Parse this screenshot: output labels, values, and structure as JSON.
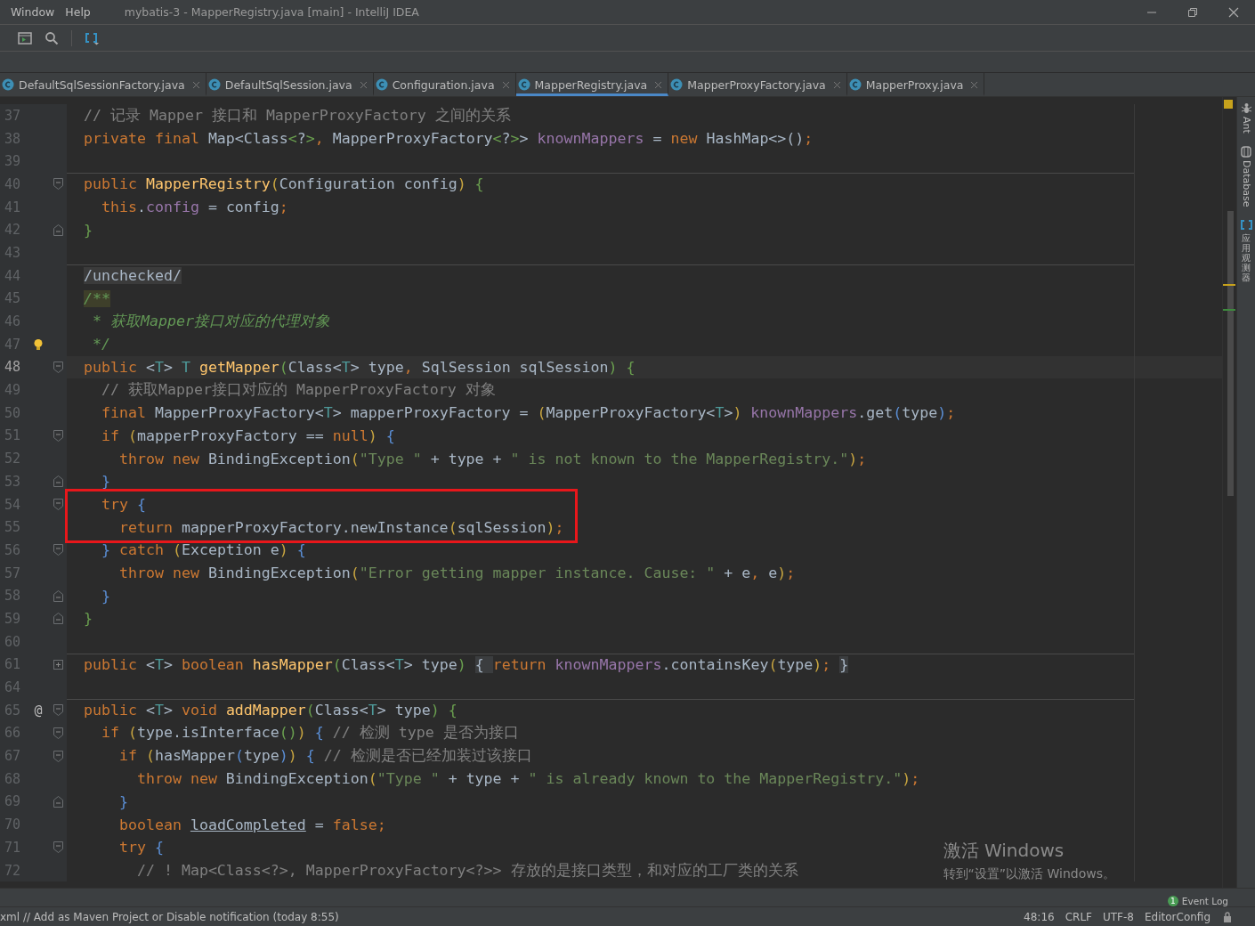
{
  "title_bar": {
    "menu": [
      "Window",
      "Help"
    ],
    "title": "mybatis-3 - MapperRegistry.java [main] - IntelliJ IDEA"
  },
  "tabs": [
    {
      "label": "DefaultSqlSessionFactory.java",
      "selected": false
    },
    {
      "label": "DefaultSqlSession.java",
      "selected": false
    },
    {
      "label": "Configuration.java",
      "selected": false
    },
    {
      "label": "MapperRegistry.java",
      "selected": true
    },
    {
      "label": "MapperProxyFactory.java",
      "selected": false
    },
    {
      "label": "MapperProxy.java",
      "selected": false
    }
  ],
  "tool_strip": [
    {
      "kind": "ant",
      "label": "Ant"
    },
    {
      "kind": "database",
      "label": "Database"
    },
    {
      "kind": "observer",
      "label": "应用观测器"
    }
  ],
  "editor": {
    "lines": [
      {
        "number": "37",
        "current": false,
        "highlighted": false,
        "divider_above": false,
        "code": [
          {
            "kind": "cm",
            "text": "// 记录 Mapper 接口和 MapperProxyFactory 之间的关系"
          }
        ]
      },
      {
        "number": "38",
        "current": false,
        "highlighted": false,
        "divider_above": false,
        "code": [
          {
            "kind": "kw",
            "text": "private final "
          },
          {
            "kind": "pl",
            "text": "Map<Class"
          },
          {
            "kind": "g",
            "text": "<"
          },
          {
            "kind": "pl",
            "text": "?"
          },
          {
            "kind": "g",
            "text": ">"
          },
          {
            "kind": "kw",
            "text": ", "
          },
          {
            "kind": "pl",
            "text": "MapperProxyFactory"
          },
          {
            "kind": "g",
            "text": "<"
          },
          {
            "kind": "pl",
            "text": "?"
          },
          {
            "kind": "g",
            "text": ">"
          },
          {
            "kind": "pl",
            "text": "> "
          },
          {
            "kind": "fld",
            "text": "knownMappers"
          },
          {
            "kind": "pl",
            "text": " = "
          },
          {
            "kind": "kw",
            "text": "new "
          },
          {
            "kind": "pl",
            "text": "HashMap<>()"
          },
          {
            "kind": "kw",
            "text": ";"
          }
        ]
      },
      {
        "number": "39",
        "current": false,
        "highlighted": false,
        "divider_above": false
      },
      {
        "number": "40",
        "current": false,
        "highlighted": false,
        "divider_above": true,
        "fold": {
          "kind": "start"
        },
        "code": [
          {
            "kind": "kw",
            "text": "public "
          },
          {
            "kind": "fn",
            "text": "MapperRegistry"
          },
          {
            "kind": "y",
            "text": "("
          },
          {
            "kind": "pl",
            "text": "Configuration config"
          },
          {
            "kind": "y",
            "text": ")"
          },
          {
            "kind": "g",
            "text": " {"
          }
        ]
      },
      {
        "number": "41",
        "current": false,
        "highlighted": false,
        "divider_above": false,
        "code": [
          {
            "kind": "kw",
            "text": "  this"
          },
          {
            "kind": "pl",
            "text": "."
          },
          {
            "kind": "fld",
            "text": "config"
          },
          {
            "kind": "pl",
            "text": " = config"
          },
          {
            "kind": "kw",
            "text": ";"
          }
        ]
      },
      {
        "number": "42",
        "current": false,
        "highlighted": false,
        "divider_above": false,
        "fold": {
          "kind": "end"
        },
        "code": [
          {
            "kind": "g",
            "text": "}"
          }
        ]
      },
      {
        "number": "43",
        "current": false,
        "highlighted": false,
        "divider_above": false
      },
      {
        "number": "44",
        "current": false,
        "highlighted": false,
        "divider_above": true,
        "code": [
          {
            "kind": "ann",
            "text": "/unchecked/"
          }
        ]
      },
      {
        "number": "45",
        "current": false,
        "highlighted": false,
        "divider_above": false,
        "code": [
          {
            "kind": "docm",
            "text": "/**"
          }
        ]
      },
      {
        "number": "46",
        "current": false,
        "highlighted": false,
        "divider_above": false,
        "code": [
          {
            "kind": "doc",
            "text": " * 获取Mapper接口对应的代理对象"
          }
        ]
      },
      {
        "number": "47",
        "current": false,
        "highlighted": false,
        "divider_above": false,
        "gutter_icon": {
          "kind": "bulb"
        },
        "code": [
          {
            "kind": "doc",
            "text": " */"
          }
        ]
      },
      {
        "number": "48",
        "current": true,
        "highlighted": false,
        "divider_above": false,
        "fold": {
          "kind": "start"
        },
        "code": [
          {
            "kind": "kw",
            "text": "public "
          },
          {
            "kind": "pl",
            "text": "<"
          },
          {
            "kind": "tp",
            "text": "T"
          },
          {
            "kind": "pl",
            "text": "> "
          },
          {
            "kind": "tp",
            "text": "T "
          },
          {
            "kind": "fn",
            "text": "getMapper"
          },
          {
            "kind": "g",
            "text": "("
          },
          {
            "kind": "pl",
            "text": "Class<"
          },
          {
            "kind": "tp",
            "text": "T"
          },
          {
            "kind": "pl",
            "text": "> type"
          },
          {
            "kind": "kw",
            "text": ", "
          },
          {
            "kind": "pl",
            "text": "SqlSession sqlSession"
          },
          {
            "kind": "g",
            "text": ") {"
          }
        ]
      },
      {
        "number": "49",
        "current": false,
        "highlighted": false,
        "divider_above": false,
        "code": [
          {
            "kind": "cm",
            "text": "  // 获取Mapper接口对应的 MapperProxyFactory 对象"
          }
        ]
      },
      {
        "number": "50",
        "current": false,
        "highlighted": false,
        "divider_above": false,
        "code": [
          {
            "kind": "kw",
            "text": "  final "
          },
          {
            "kind": "pl",
            "text": "MapperProxyFactory<"
          },
          {
            "kind": "tp",
            "text": "T"
          },
          {
            "kind": "pl",
            "text": "> mapperProxyFactory = "
          },
          {
            "kind": "y",
            "text": "("
          },
          {
            "kind": "pl",
            "text": "MapperProxyFactory<"
          },
          {
            "kind": "tp",
            "text": "T"
          },
          {
            "kind": "pl",
            "text": ">"
          },
          {
            "kind": "y",
            "text": ")"
          },
          {
            "kind": "fld",
            "text": " knownMappers"
          },
          {
            "kind": "pl",
            "text": ".get"
          },
          {
            "kind": "bl",
            "text": "("
          },
          {
            "kind": "pl",
            "text": "type"
          },
          {
            "kind": "bl",
            "text": ")"
          },
          {
            "kind": "kw",
            "text": ";"
          }
        ]
      },
      {
        "number": "51",
        "current": false,
        "highlighted": false,
        "divider_above": false,
        "fold": {
          "kind": "start"
        },
        "code": [
          {
            "kind": "kw",
            "text": "  if "
          },
          {
            "kind": "y",
            "text": "("
          },
          {
            "kind": "pl",
            "text": "mapperProxyFactory == "
          },
          {
            "kind": "kw",
            "text": "null"
          },
          {
            "kind": "y",
            "text": ")"
          },
          {
            "kind": "bl",
            "text": " {"
          }
        ]
      },
      {
        "number": "52",
        "current": false,
        "highlighted": false,
        "divider_above": false,
        "code": [
          {
            "kind": "kw",
            "text": "    throw new "
          },
          {
            "kind": "pl",
            "text": "BindingException"
          },
          {
            "kind": "y",
            "text": "("
          },
          {
            "kind": "str",
            "text": "\"Type \""
          },
          {
            "kind": "pl",
            "text": " + type + "
          },
          {
            "kind": "str",
            "text": "\" is not known to the MapperRegistry.\""
          },
          {
            "kind": "y",
            "text": ")"
          },
          {
            "kind": "kw",
            "text": ";"
          }
        ]
      },
      {
        "number": "53",
        "current": false,
        "highlighted": false,
        "divider_above": false,
        "fold": {
          "kind": "end"
        },
        "code": [
          {
            "kind": "bl",
            "text": "  }"
          }
        ]
      },
      {
        "number": "54",
        "current": false,
        "highlighted": true,
        "divider_above": false,
        "fold": {
          "kind": "start"
        },
        "code": [
          {
            "kind": "kw",
            "text": "  try "
          },
          {
            "kind": "bl",
            "text": "{"
          }
        ]
      },
      {
        "number": "55",
        "current": false,
        "highlighted": true,
        "divider_above": false,
        "code": [
          {
            "kind": "kw",
            "text": "    return "
          },
          {
            "kind": "pl",
            "text": "mapperProxyFactory.newInstance"
          },
          {
            "kind": "y",
            "text": "("
          },
          {
            "kind": "pl",
            "text": "sqlSession"
          },
          {
            "kind": "y",
            "text": ")"
          },
          {
            "kind": "kw",
            "text": ";"
          }
        ]
      },
      {
        "number": "56",
        "current": false,
        "highlighted": false,
        "divider_above": false,
        "fold": {
          "kind": "start"
        },
        "code": [
          {
            "kind": "bl",
            "text": "  } "
          },
          {
            "kind": "kw",
            "text": "catch "
          },
          {
            "kind": "y",
            "text": "("
          },
          {
            "kind": "pl",
            "text": "Exception e"
          },
          {
            "kind": "y",
            "text": ")"
          },
          {
            "kind": "bl",
            "text": " {"
          }
        ]
      },
      {
        "number": "57",
        "current": false,
        "highlighted": false,
        "divider_above": false,
        "code": [
          {
            "kind": "kw",
            "text": "    throw new "
          },
          {
            "kind": "pl",
            "text": "BindingException"
          },
          {
            "kind": "y",
            "text": "("
          },
          {
            "kind": "str",
            "text": "\"Error getting mapper instance. Cause: \""
          },
          {
            "kind": "pl",
            "text": " + e"
          },
          {
            "kind": "kw",
            "text": ", "
          },
          {
            "kind": "pl",
            "text": "e"
          },
          {
            "kind": "y",
            "text": ")"
          },
          {
            "kind": "kw",
            "text": ";"
          }
        ]
      },
      {
        "number": "58",
        "current": false,
        "highlighted": false,
        "divider_above": false,
        "fold": {
          "kind": "end"
        },
        "code": [
          {
            "kind": "bl",
            "text": "  }"
          }
        ]
      },
      {
        "number": "59",
        "current": false,
        "highlighted": false,
        "divider_above": false,
        "fold": {
          "kind": "end"
        },
        "code": [
          {
            "kind": "g",
            "text": "}"
          }
        ]
      },
      {
        "number": "60",
        "current": false,
        "highlighted": false,
        "divider_above": false
      },
      {
        "number": "61",
        "current": false,
        "highlighted": false,
        "divider_above": true,
        "fold": {
          "kind": "collapsed"
        },
        "code": [
          {
            "kind": "kw",
            "text": "public "
          },
          {
            "kind": "pl",
            "text": "<"
          },
          {
            "kind": "tp",
            "text": "T"
          },
          {
            "kind": "pl",
            "text": "> "
          },
          {
            "kind": "kw",
            "text": "boolean "
          },
          {
            "kind": "fn",
            "text": "hasMapper"
          },
          {
            "kind": "g",
            "text": "("
          },
          {
            "kind": "pl",
            "text": "Class<"
          },
          {
            "kind": "tp",
            "text": "T"
          },
          {
            "kind": "pl",
            "text": "> type"
          },
          {
            "kind": "g",
            "text": ") "
          },
          {
            "kind": "fold",
            "text": "{ "
          },
          {
            "kind": "kw",
            "text": "return "
          },
          {
            "kind": "fld",
            "text": "knownMappers"
          },
          {
            "kind": "pl",
            "text": ".containsKey"
          },
          {
            "kind": "y",
            "text": "("
          },
          {
            "kind": "pl",
            "text": "type"
          },
          {
            "kind": "y",
            "text": ")"
          },
          {
            "kind": "kw",
            "text": "; "
          },
          {
            "kind": "fold",
            "text": "}"
          }
        ]
      },
      {
        "number": "64",
        "current": false,
        "highlighted": false,
        "divider_above": false
      },
      {
        "number": "65",
        "current": false,
        "highlighted": false,
        "divider_above": true,
        "fold": {
          "kind": "start"
        },
        "gutter_mark": "@",
        "code": [
          {
            "kind": "kw",
            "text": "public "
          },
          {
            "kind": "pl",
            "text": "<"
          },
          {
            "kind": "tp",
            "text": "T"
          },
          {
            "kind": "pl",
            "text": "> "
          },
          {
            "kind": "kw",
            "text": "void "
          },
          {
            "kind": "fn",
            "text": "addMapper"
          },
          {
            "kind": "g",
            "text": "("
          },
          {
            "kind": "pl",
            "text": "Class<"
          },
          {
            "kind": "tp",
            "text": "T"
          },
          {
            "kind": "pl",
            "text": "> type"
          },
          {
            "kind": "g",
            "text": ") {"
          }
        ]
      },
      {
        "number": "66",
        "current": false,
        "highlighted": false,
        "divider_above": false,
        "fold": {
          "kind": "start"
        },
        "code": [
          {
            "kind": "kw",
            "text": "  if "
          },
          {
            "kind": "y",
            "text": "("
          },
          {
            "kind": "pl",
            "text": "type.isInterface"
          },
          {
            "kind": "g",
            "text": "()"
          },
          {
            "kind": "y",
            "text": ")"
          },
          {
            "kind": "bl",
            "text": " {"
          },
          {
            "kind": "cm",
            "text": " // 检测 type 是否为接口"
          }
        ]
      },
      {
        "number": "67",
        "current": false,
        "highlighted": false,
        "divider_above": false,
        "fold": {
          "kind": "start"
        },
        "code": [
          {
            "kind": "kw",
            "text": "    if "
          },
          {
            "kind": "y",
            "text": "("
          },
          {
            "kind": "pl",
            "text": "hasMapper"
          },
          {
            "kind": "bl",
            "text": "("
          },
          {
            "kind": "pl",
            "text": "type"
          },
          {
            "kind": "bl",
            "text": ")"
          },
          {
            "kind": "y",
            "text": ")"
          },
          {
            "kind": "bl",
            "text": " {"
          },
          {
            "kind": "cm",
            "text": " // 检测是否已经加装过该接口"
          }
        ]
      },
      {
        "number": "68",
        "current": false,
        "highlighted": false,
        "divider_above": false,
        "code": [
          {
            "kind": "kw",
            "text": "      throw new "
          },
          {
            "kind": "pl",
            "text": "BindingException"
          },
          {
            "kind": "y",
            "text": "("
          },
          {
            "kind": "str",
            "text": "\"Type \""
          },
          {
            "kind": "pl",
            "text": " + type + "
          },
          {
            "kind": "str",
            "text": "\" is already known to the MapperRegistry.\""
          },
          {
            "kind": "y",
            "text": ")"
          },
          {
            "kind": "kw",
            "text": ";"
          }
        ]
      },
      {
        "number": "69",
        "current": false,
        "highlighted": false,
        "divider_above": false,
        "fold": {
          "kind": "end"
        },
        "code": [
          {
            "kind": "bl",
            "text": "    }"
          }
        ]
      },
      {
        "number": "70",
        "current": false,
        "highlighted": false,
        "divider_above": false,
        "code": [
          {
            "kind": "kw",
            "text": "    boolean "
          },
          {
            "kind": "ul",
            "text": "loadCompleted"
          },
          {
            "kind": "pl",
            "text": " = "
          },
          {
            "kind": "kw",
            "text": "false;"
          }
        ]
      },
      {
        "number": "71",
        "current": false,
        "highlighted": false,
        "divider_above": false,
        "fold": {
          "kind": "start"
        },
        "code": [
          {
            "kind": "kw",
            "text": "    try "
          },
          {
            "kind": "bl",
            "text": "{"
          }
        ]
      },
      {
        "number": "72",
        "current": false,
        "highlighted": false,
        "divider_above": false,
        "code": [
          {
            "kind": "cm",
            "text": "      // ! Map<Class<?>, MapperProxyFactory<?>> 存放的是接口类型，和对应的工厂类的关系"
          }
        ]
      }
    ]
  },
  "activation_notice": {
    "title": "激活 Windows",
    "text": "转到“设置”以激活 Windows。"
  },
  "event_log": {
    "badge": "1",
    "label": "Event Log"
  },
  "status_bar": {
    "message": "xml // Add as Maven Project or Disable notification (today 8:55)",
    "items": [
      "48:16",
      "CRLF",
      "UTF-8",
      "EditorConfig"
    ]
  }
}
